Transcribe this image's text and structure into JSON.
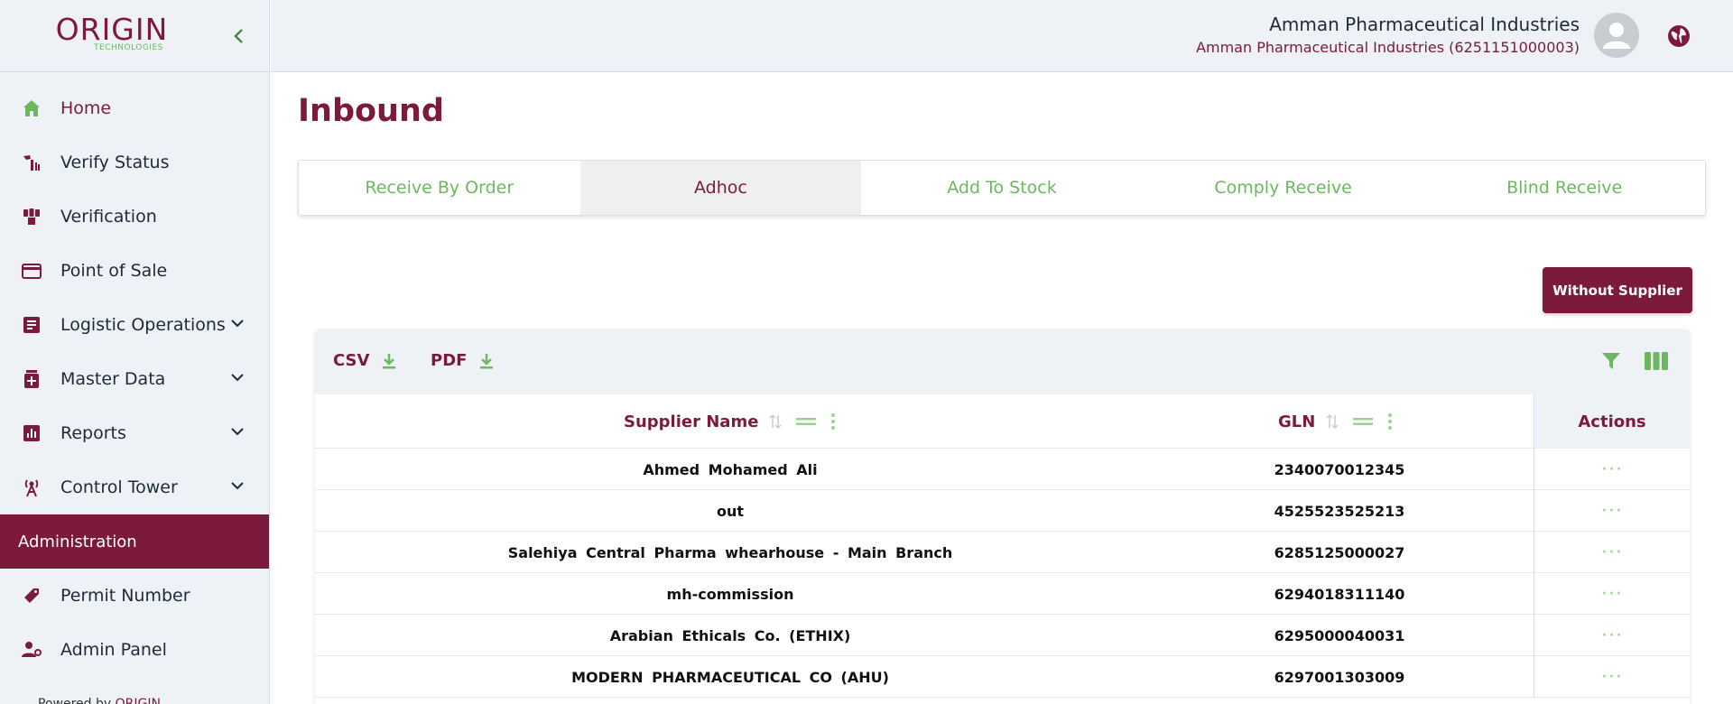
{
  "brand": {
    "logo_text": "ORIGIN",
    "logo_sub": "TECHNOLOGIES"
  },
  "colors": {
    "primary": "#7c1a3c",
    "accent_green": "#6db85f",
    "sidebar_bg": "#eef1f6"
  },
  "sidebar": {
    "items": [
      {
        "label": "Home",
        "icon": "home-icon"
      },
      {
        "label": "Verify Status",
        "icon": "verify-status-icon"
      },
      {
        "label": "Verification",
        "icon": "verification-icon"
      },
      {
        "label": "Point of Sale",
        "icon": "credit-card-icon"
      },
      {
        "label": "Logistic Operations",
        "icon": "document-icon",
        "expandable": true
      },
      {
        "label": "Master Data",
        "icon": "medicine-icon",
        "expandable": true
      },
      {
        "label": "Reports",
        "icon": "bar-chart-icon",
        "expandable": true
      },
      {
        "label": "Control Tower",
        "icon": "tower-icon",
        "expandable": true
      }
    ],
    "section_label": "Administration",
    "admin_items": [
      {
        "label": "Permit Number",
        "icon": "tag-icon"
      },
      {
        "label": "Admin Panel",
        "icon": "user-cog-icon"
      }
    ],
    "footer": {
      "prefix": "Powered by",
      "brand": "ORIGIN"
    }
  },
  "header": {
    "company_name": "Amman Pharmaceutical Industries",
    "company_sub": "Amman Pharmaceutical Industries (6251151000003)"
  },
  "page": {
    "title": "Inbound",
    "tabs": [
      "Receive By Order",
      "Adhoc",
      "Add To Stock",
      "Comply Receive",
      "Blind Receive"
    ],
    "active_tab": "Adhoc",
    "without_supplier_label": "Without Supplier"
  },
  "grid": {
    "export_csv": "CSV",
    "export_pdf": "PDF",
    "columns": {
      "supplier_name": "Supplier Name",
      "gln": "GLN",
      "actions": "Actions"
    },
    "rows": [
      {
        "supplier_name": "Ahmed Mohamed Ali",
        "gln": "2340070012345"
      },
      {
        "supplier_name": "out",
        "gln": "4525523525213"
      },
      {
        "supplier_name": "Salehiya Central Pharma whearhouse - Main Branch",
        "gln": "6285125000027"
      },
      {
        "supplier_name": "mh-commission",
        "gln": "6294018311140"
      },
      {
        "supplier_name": "Arabian Ethicals Co. (ETHIX)",
        "gln": "6295000040031"
      },
      {
        "supplier_name": "MODERN PHARMACEUTICAL CO (AHU)",
        "gln": "6297001303009"
      }
    ],
    "action_glyph": "···"
  }
}
